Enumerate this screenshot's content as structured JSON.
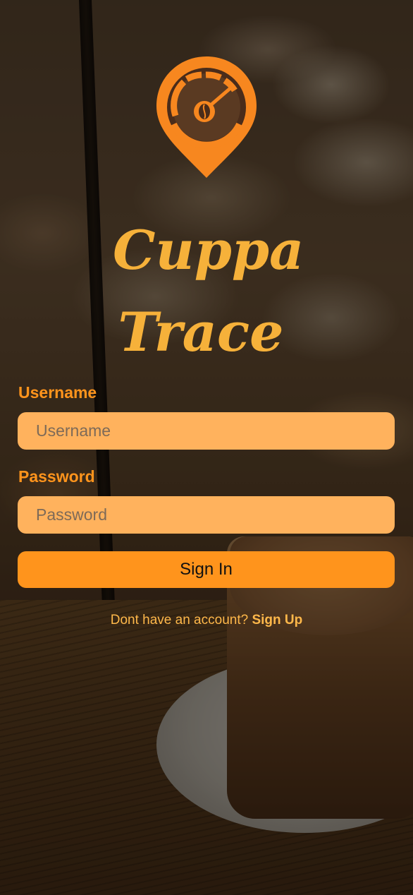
{
  "app": {
    "brand_line1": "Cuppa",
    "brand_line2": "Trace"
  },
  "form": {
    "username_label": "Username",
    "username_placeholder": "Username",
    "username_value": "",
    "password_label": "Password",
    "password_placeholder": "Password",
    "password_value": "",
    "signin_label": "Sign In"
  },
  "footer": {
    "prompt": "Dont have an account?",
    "signup_label": "Sign Up"
  },
  "icons": {
    "logo": "speedometer-map-pin-coffee-bean-icon"
  },
  "colors": {
    "accent": "#ff941c",
    "field_bg": "#ffb25d",
    "brand_text": "#f6b13a",
    "logo_orange": "#f7871f",
    "logo_dark": "#4a2c1a"
  }
}
